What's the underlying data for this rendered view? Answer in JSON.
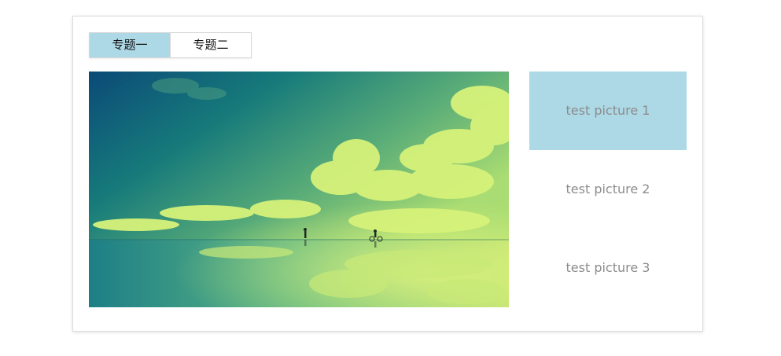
{
  "tabs": [
    {
      "label": "专题一",
      "active": true
    },
    {
      "label": "专题二",
      "active": false
    }
  ],
  "main_image": {
    "description_icon": "landscape-photo"
  },
  "thumbnails": [
    {
      "label": "test picture 1",
      "active": true
    },
    {
      "label": "test picture 2",
      "active": false
    },
    {
      "label": "test picture 3",
      "active": false
    }
  ],
  "colors": {
    "active_bg": "#add8e6",
    "thumb_text": "#8c8c8c",
    "border": "#dcdcdc"
  }
}
